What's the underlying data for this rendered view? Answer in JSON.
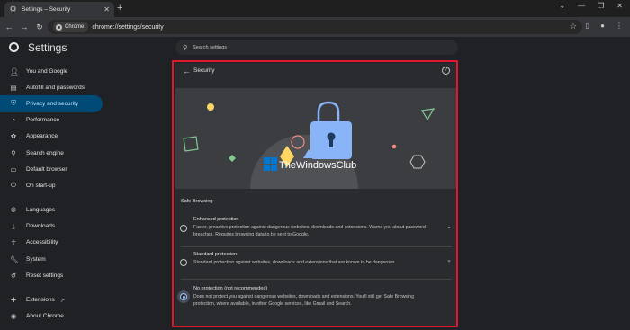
{
  "browser": {
    "tab_title": "Settings – Security",
    "tab_icon": "gear-icon",
    "chip_label": "Chrome",
    "url": "chrome://settings/security"
  },
  "settings": {
    "title": "Settings",
    "search_placeholder": "Search settings"
  },
  "sidebar": {
    "items": [
      {
        "label": "You and Google",
        "icon": "person-icon"
      },
      {
        "label": "Autofill and passwords",
        "icon": "clipboard-icon"
      },
      {
        "label": "Privacy and security",
        "icon": "shield-icon",
        "active": true
      },
      {
        "label": "Performance",
        "icon": "speedometer-icon"
      },
      {
        "label": "Appearance",
        "icon": "palette-icon"
      },
      {
        "label": "Search engine",
        "icon": "search-icon"
      },
      {
        "label": "Default browser",
        "icon": "browser-icon"
      },
      {
        "label": "On start-up",
        "icon": "power-icon"
      },
      {
        "label": "Languages",
        "icon": "globe-icon"
      },
      {
        "label": "Downloads",
        "icon": "download-icon"
      },
      {
        "label": "Accessibility",
        "icon": "accessibility-icon"
      },
      {
        "label": "System",
        "icon": "wrench-icon"
      },
      {
        "label": "Reset settings",
        "icon": "history-icon"
      },
      {
        "label": "Extensions",
        "icon": "puzzle-icon"
      },
      {
        "label": "About Chrome",
        "icon": "chrome-icon"
      }
    ]
  },
  "security": {
    "title": "Security",
    "illustration_watermark": "TheWindowsClub",
    "safe_browsing_label": "Safe Browsing",
    "options": [
      {
        "title": "Enhanced protection",
        "description": "Faster, proactive protection against dangerous websites, downloads and extensions. Warns you about password breaches. Requires browsing data to be sent to Google.",
        "selected": false
      },
      {
        "title": "Standard protection",
        "description": "Standard protection against websites, downloads and extensions that are known to be dangerous",
        "selected": false
      },
      {
        "title": "No protection (not recommended)",
        "description": "Does not protect you against dangerous websites, downloads and extensions. You'll still get Safe Browsing protection, where available, in other Google services, like Gmail and Search.",
        "selected": true
      }
    ]
  },
  "colors": {
    "highlight_frame": "#e0182d",
    "active_nav": "#004a77",
    "accent": "#a8c7fa"
  }
}
